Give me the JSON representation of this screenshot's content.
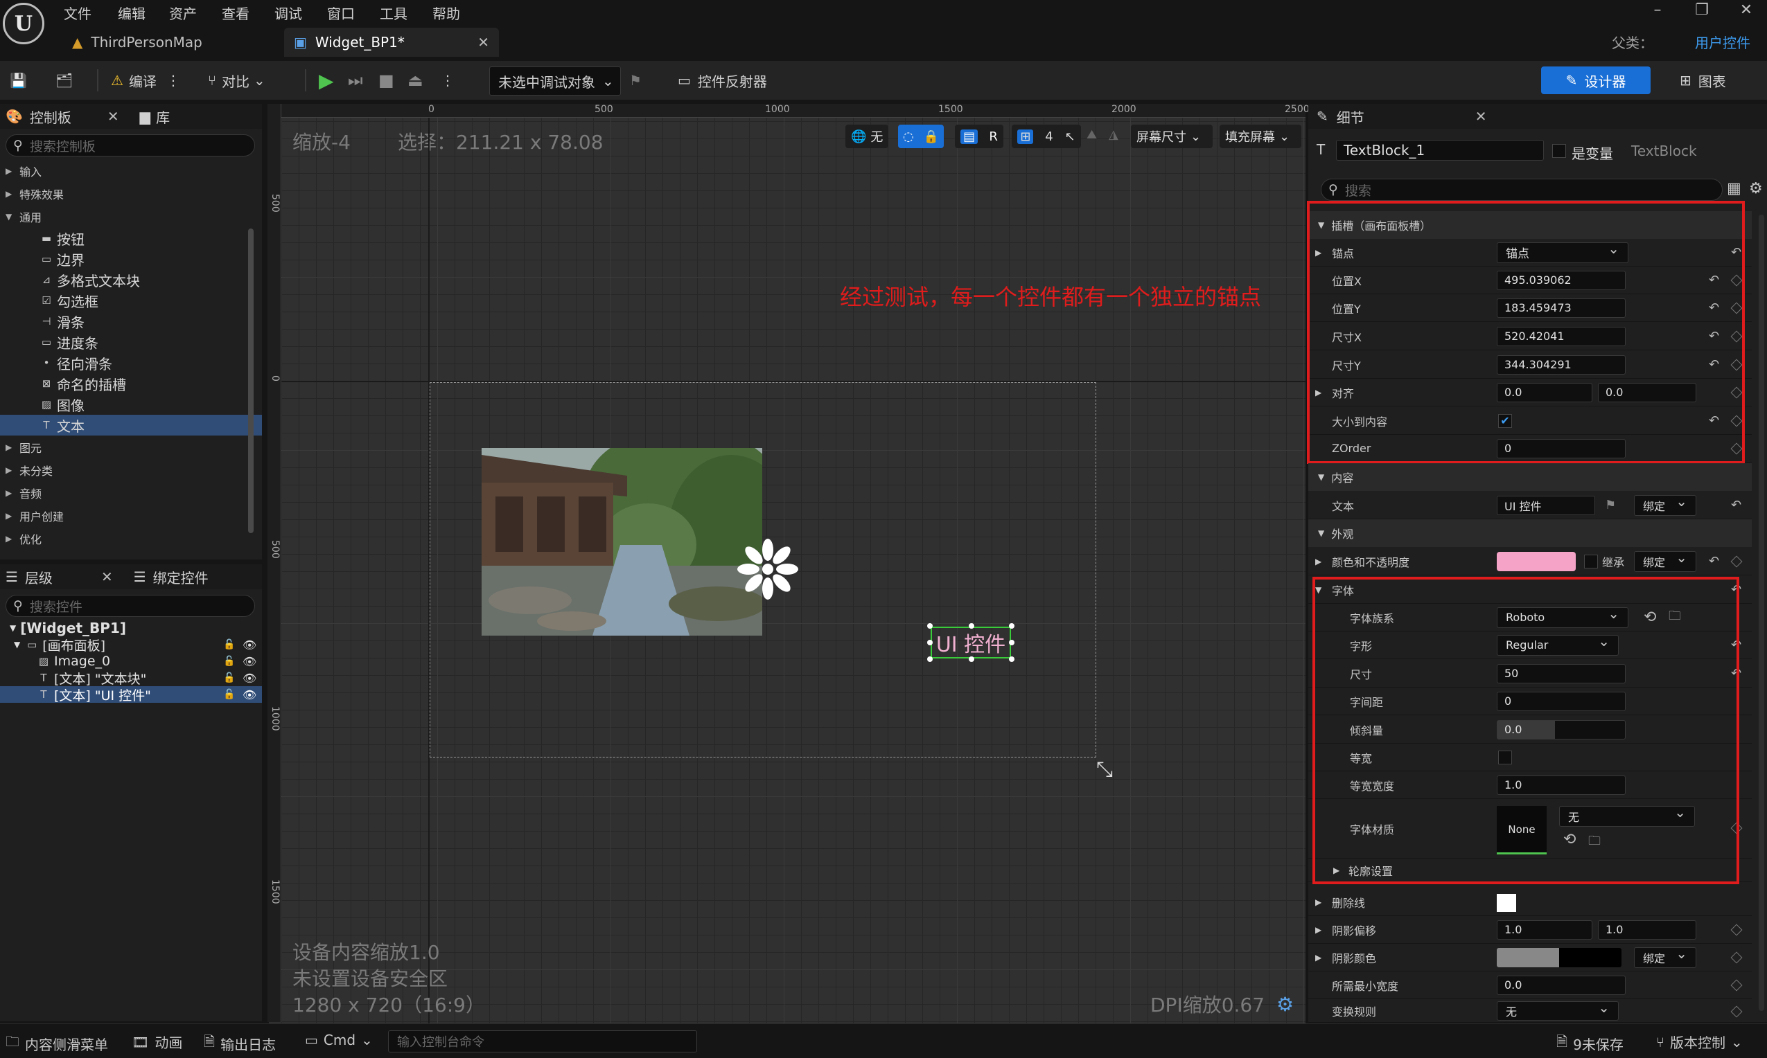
{
  "app": {
    "menu": [
      "文件",
      "编辑",
      "资产",
      "查看",
      "调试",
      "窗口",
      "工具",
      "帮助"
    ],
    "tabs": [
      "ThirdPersonMap",
      "Widget_BP1*"
    ],
    "parent_label": "父类：",
    "parent_value": "用户控件"
  },
  "toolbar": {
    "compile": "编译",
    "diff": "对比",
    "debug_target": "未选中调试对象",
    "widget_reflector": "控件反射器",
    "designer": "设计器",
    "graph": "图表"
  },
  "palette": {
    "tab_palette": "控制板",
    "tab_library": "库",
    "search_placeholder": "搜索控制板",
    "categories_top": [
      "输入",
      "特殊效果",
      "通用"
    ],
    "common_items": [
      "按钮",
      "边界",
      "多格式文本块",
      "勾选框",
      "滑条",
      "进度条",
      "径向滑条",
      "命名的插槽",
      "图像",
      "文本"
    ],
    "categories_bottom": [
      "图元",
      "未分类",
      "音频",
      "用户创建",
      "优化"
    ]
  },
  "hierarchy": {
    "tab_hierarchy": "层级",
    "tab_bind": "绑定控件",
    "search_placeholder": "搜索控件",
    "items": [
      "[Widget_BP1]",
      "[画布面板]",
      "Image_0",
      "[文本] \"文本块\"",
      "[文本] \"UI 控件\""
    ]
  },
  "viewport": {
    "zoom": "缩放-4",
    "selection": "选择：211.21 x 78.08",
    "ruler_top": [
      "0",
      "500",
      "1000",
      "1500",
      "2000",
      "2500"
    ],
    "ruler_left": [
      "500",
      "0",
      "500",
      "1000",
      "1500"
    ],
    "toolbar_none": "无",
    "toolbar_r": "R",
    "toolbar_grid": "4",
    "screen_size": "屏幕尺寸",
    "fill_screen": "填充屏幕",
    "annotation": "经过测试，每一个控件都有一个独立的锚点",
    "widget_text": "UI 控件",
    "device_scale": "设备内容缩放1.0",
    "safe_zone": "未设置设备安全区",
    "resolution": "1280 x 720（16:9）",
    "dpi": "DPI缩放0.67"
  },
  "details": {
    "tab": "细节",
    "widget_name": "TextBlock_1",
    "is_variable": "是变量",
    "widget_type": "TextBlock",
    "search_placeholder": "搜索",
    "slot_section": "插槽（画布面板槽）",
    "anchor_label": "锚点",
    "anchor_value": "锚点",
    "pos_x_label": "位置X",
    "pos_x": "495.039062",
    "pos_y_label": "位置Y",
    "pos_y": "183.459473",
    "size_x_label": "尺寸X",
    "size_x": "520.42041",
    "size_y_label": "尺寸Y",
    "size_y": "344.304291",
    "align_label": "对齐",
    "align_x": "0.0",
    "align_y": "0.0",
    "size_to_content": "大小到内容",
    "zorder_label": "ZOrder",
    "zorder": "0",
    "content_section": "内容",
    "text_label": "文本",
    "text_value": "UI 控件",
    "bind": "绑定",
    "appearance_section": "外观",
    "color_label": "颜色和不透明度",
    "inherit": "继承",
    "font_section": "字体",
    "font_family_label": "字体族系",
    "font_family": "Roboto",
    "typeface_label": "字形",
    "typeface": "Regular",
    "font_size_label": "尺寸",
    "font_size": "50",
    "letter_spacing_label": "字间距",
    "letter_spacing": "0",
    "skew_label": "倾斜量",
    "skew": "0.0",
    "monospace_label": "等宽",
    "mono_width_label": "等宽宽度",
    "mono_width": "1.0",
    "font_material_label": "字体材质",
    "font_material_thumb": "None",
    "font_material_value": "无",
    "outline_label": "轮廓设置",
    "strike_label": "删除线",
    "shadow_offset_label": "阴影偏移",
    "shadow_offset_x": "1.0",
    "shadow_offset_y": "1.0",
    "shadow_color_label": "阴影颜色",
    "min_width_label": "所需最小宽度",
    "min_width": "0.0",
    "transform_label": "变换规则",
    "transform_value": "无"
  },
  "statusbar": {
    "content_drawer": "内容侧滑菜单",
    "animation": "动画",
    "output_log": "输出日志",
    "cmd": "Cmd",
    "console_placeholder": "输入控制台命令",
    "unsaved": "9未保存",
    "source_control": "版本控制"
  },
  "colors": {
    "accent_blue": "#1a6fd6",
    "selection_blue": "#304d78",
    "annotation_red": "#e01c1c",
    "color_swatch": "#f5a3c7"
  }
}
